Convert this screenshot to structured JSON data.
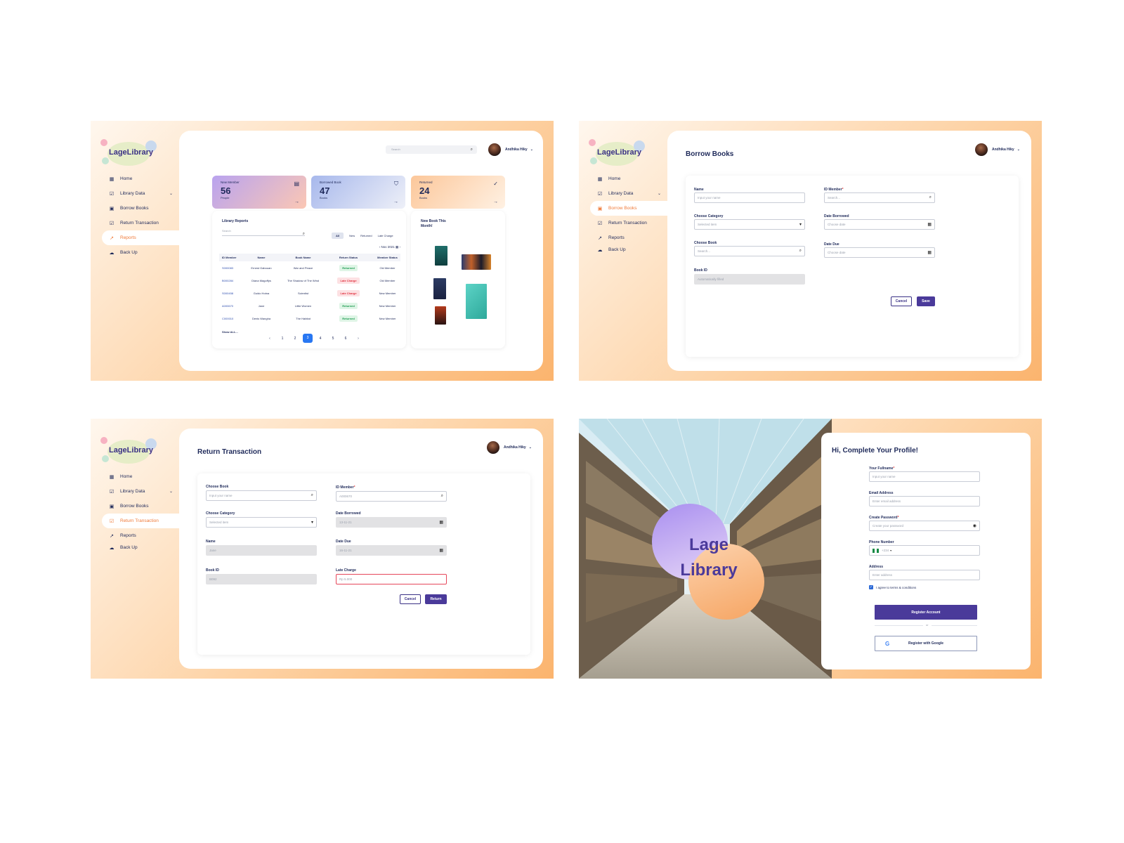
{
  "brand": {
    "logo_text": "LageLibrary",
    "logo_big_line1": "Lage",
    "logo_big_line2": "Library"
  },
  "user": {
    "name": "Andhika Hiky"
  },
  "nav": {
    "home": "Home",
    "library_data": "Library Data",
    "borrow": "Borrow Books",
    "return": "Return Transaction",
    "reports": "Reports",
    "backup": "Back Up"
  },
  "dashboard": {
    "search_placeholder": "Search",
    "stats": [
      {
        "label": "New Member",
        "value": "56",
        "unit": "People"
      },
      {
        "label": "Borrowed Book",
        "value": "47",
        "unit": "Books"
      },
      {
        "label": "Returned",
        "value": "24",
        "unit": "Books"
      }
    ],
    "reports_title": "Library Reports",
    "reports_search": "Search",
    "filters": [
      "All",
      "New",
      "Returned",
      "Late Charge"
    ],
    "month": "Nov 2021",
    "columns": [
      "ID Member",
      "Name",
      "Book Name",
      "Return Status",
      "Member Status"
    ],
    "rows": [
      {
        "id": "S000083",
        "name": "Ernest Gabouan",
        "book": "War and Peace",
        "status": "Returned",
        "member": "Old Member"
      },
      {
        "id": "B000284",
        "name": "Diana Magoffys",
        "book": "The Shadow of The Wind",
        "status": "Late Charge",
        "member": "Old Member"
      },
      {
        "id": "S000458",
        "name": "Guido Hotna",
        "book": "Scientist",
        "status": "Late Charge",
        "member": "New Member"
      },
      {
        "id": "A000670",
        "name": "Jane",
        "book": "Little Women",
        "status": "Returned",
        "member": "New Member"
      },
      {
        "id": "C000010",
        "name": "Denis Wangha",
        "book": "The Habitat",
        "status": "Returned",
        "member": "New Member"
      }
    ],
    "show_all": "Show ALL...",
    "pages": [
      "1",
      "2",
      "3",
      "4",
      "5",
      "6"
    ],
    "new_books_title": "New Book This Month!"
  },
  "borrow": {
    "title": "Borrow Books",
    "name_label": "Name",
    "name_ph": "Input your name",
    "id_label": "ID Member",
    "id_ph": "Search...",
    "category_label": "Choose Category",
    "category_ph": "Selected item",
    "date_borrowed_label": "Date Borrowed",
    "date_borrowed_ph": "Choose date",
    "book_label": "Choose Book",
    "book_ph": "Search...",
    "date_due_label": "Date Due",
    "date_due_ph": "Choose date",
    "book_id_label": "Book ID",
    "book_id_ph": "Automatically filled",
    "cancel": "Cancel",
    "save": "Save"
  },
  "return": {
    "title": "Return Transaction",
    "book_label": "Choose Book",
    "book_ph": "Input your name",
    "id_label": "ID Member",
    "id_value": "A000670",
    "category_label": "Choose Category",
    "category_ph": "Selected item",
    "date_borrowed_label": "Date Borrowed",
    "date_borrowed_value": "13-11-21",
    "name_label": "Name",
    "name_value": "Jane",
    "date_due_label": "Date Due",
    "date_due_value": "16-11-21",
    "book_id_label": "Book ID",
    "book_id_value": "B092",
    "late_label": "Late Charge",
    "late_value": "Rp 5.000",
    "cancel": "Cancel",
    "submit": "Return"
  },
  "register": {
    "title": "Hi, Complete Your Profile!",
    "fullname_label": "Your Fullname",
    "fullname_ph": "Input your name",
    "email_label": "Email Address",
    "email_ph": "Enter email address",
    "password_label": "Create Password",
    "password_ph": "Create your password",
    "phone_label": "Phone Number",
    "phone_code": "+234",
    "address_label": "Address",
    "address_ph": "Enter address",
    "terms": "I agree to terms & conditions",
    "register_btn": "Register Account",
    "or": "or",
    "google_btn": "Register with Google"
  }
}
